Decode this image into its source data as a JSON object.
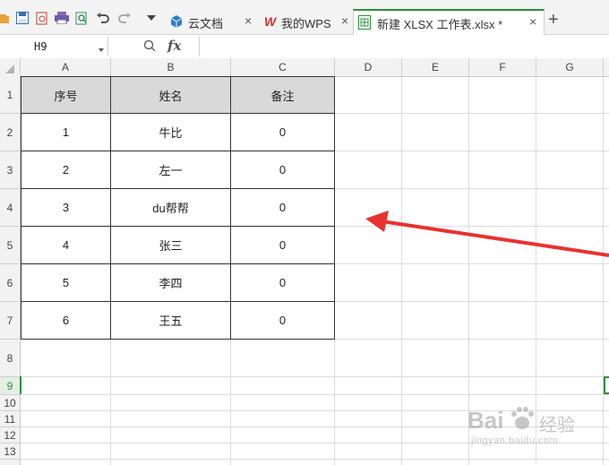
{
  "tabs": {
    "cloud_docs": "云文档",
    "my_wps": "我的WPS",
    "active_file": "新建 XLSX 工作表.xlsx *",
    "close_glyph": "×",
    "new_tab_glyph": "+"
  },
  "formula_bar": {
    "cell_ref": "H9",
    "fx_label": "fx",
    "formula_value": ""
  },
  "grid": {
    "columns": [
      "A",
      "B",
      "C",
      "D",
      "E",
      "F",
      "G"
    ],
    "rows": [
      "1",
      "2",
      "3",
      "4",
      "5",
      "6",
      "7",
      "8",
      "9",
      "10",
      "11",
      "12",
      "13"
    ],
    "active_row": "9"
  },
  "table": {
    "headers": [
      "序号",
      "姓名",
      "备注"
    ],
    "rows": [
      [
        "1",
        "牛比",
        "0"
      ],
      [
        "2",
        "左一",
        "0"
      ],
      [
        "3",
        "du帮帮",
        "0"
      ],
      [
        "4",
        "张三",
        "0"
      ],
      [
        "5",
        "李四",
        "0"
      ],
      [
        "6",
        "王五",
        "0"
      ]
    ]
  },
  "watermark": {
    "brand": "Bai",
    "brand_cn": "经验",
    "site": "jingyan.baidu.com"
  },
  "colors": {
    "accent_green": "#2a8d3d",
    "annotation_arrow": "#e8322f",
    "header_fill": "#d9d9d9"
  }
}
